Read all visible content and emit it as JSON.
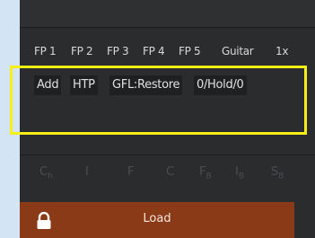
{
  "tabs": [
    "FP 1",
    "FP 2",
    "FP 3",
    "FP 4",
    "FP 5",
    "Guitar",
    "1x"
  ],
  "functions": [
    "Add",
    "HTP",
    "GFL:Restore",
    "0/Hold/0"
  ],
  "keys": [
    "C",
    "I",
    "F",
    "C",
    "F",
    "I",
    "S"
  ],
  "key_subs": [
    "h",
    "",
    "",
    "",
    "B",
    "B",
    "B"
  ],
  "load": {
    "label": "Load",
    "icon": "lock-icon"
  },
  "colors": {
    "highlight": "#f7ef16",
    "load_bar": "#8b3a18",
    "panel": "#2b2c2e"
  }
}
